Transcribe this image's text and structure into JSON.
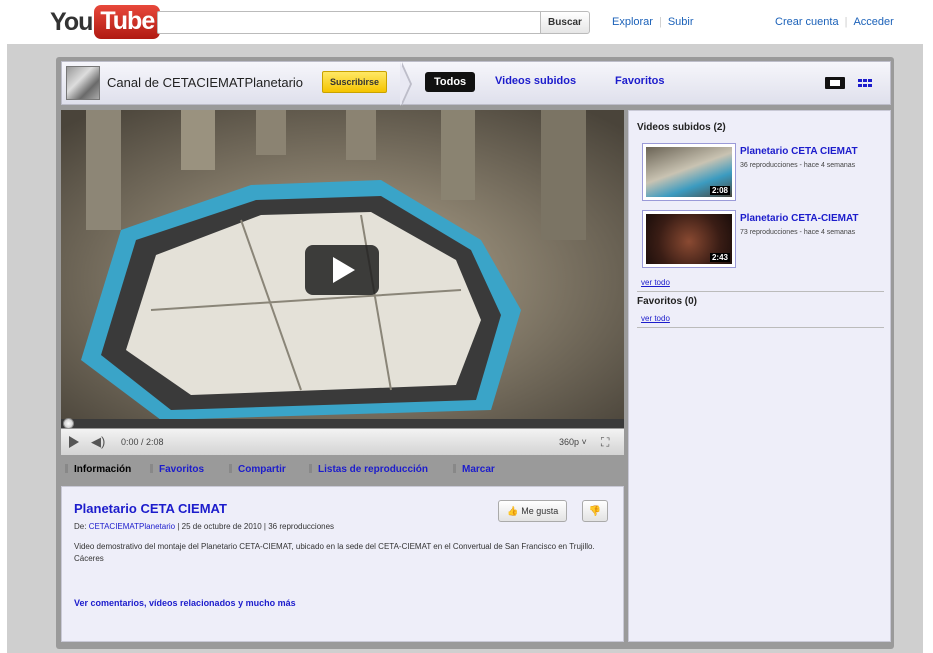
{
  "header": {
    "logo_you": "You",
    "logo_tube": "Tube",
    "search_value": "",
    "search_button": "Buscar",
    "explore": "Explorar",
    "upload": "Subir",
    "create_account": "Crear cuenta",
    "sign_in": "Acceder"
  },
  "channel": {
    "title": "Canal de CETACIEMATPlanetario",
    "subscribe": "Suscribirse",
    "tabs": {
      "all": "Todos",
      "uploads": "Videos subidos",
      "favorites": "Favoritos"
    }
  },
  "player": {
    "time": "0:00 / 2:08",
    "quality": "360p",
    "progress": 0
  },
  "info_tabs": {
    "info": "Información",
    "favorites": "Favoritos",
    "share": "Compartir",
    "playlists": "Listas de reproducción",
    "flag": "Marcar"
  },
  "video": {
    "title": "Planetario CETA CIEMAT",
    "meta_prefix": "De:",
    "author": "CETACIEMATPlanetario",
    "meta_suffix": "| 25 de octubre de 2010 | 36 reproducciones",
    "description": "Video demostrativo del montaje del Planetario CETA-CIEMAT, ubicado en la sede del CETA-CIEMAT en el Convertual de San Francisco en Trujillo. Cáceres",
    "more": "Ver comentarios, vídeos relacionados y mucho más",
    "like": "Me gusta"
  },
  "sidebar": {
    "uploads_heading": "Videos subidos (2)",
    "items": [
      {
        "title": "Planetario CETA CIEMAT",
        "stats": "36 reproducciones - hace 4 semanas",
        "duration": "2:08"
      },
      {
        "title": "Planetario CETA-CIEMAT",
        "stats": "73 reproducciones - hace 4 semanas",
        "duration": "2:43"
      }
    ],
    "see_all": "ver todo",
    "favorites_heading": "Favoritos (0)",
    "favorites_see_all": "ver todo"
  }
}
